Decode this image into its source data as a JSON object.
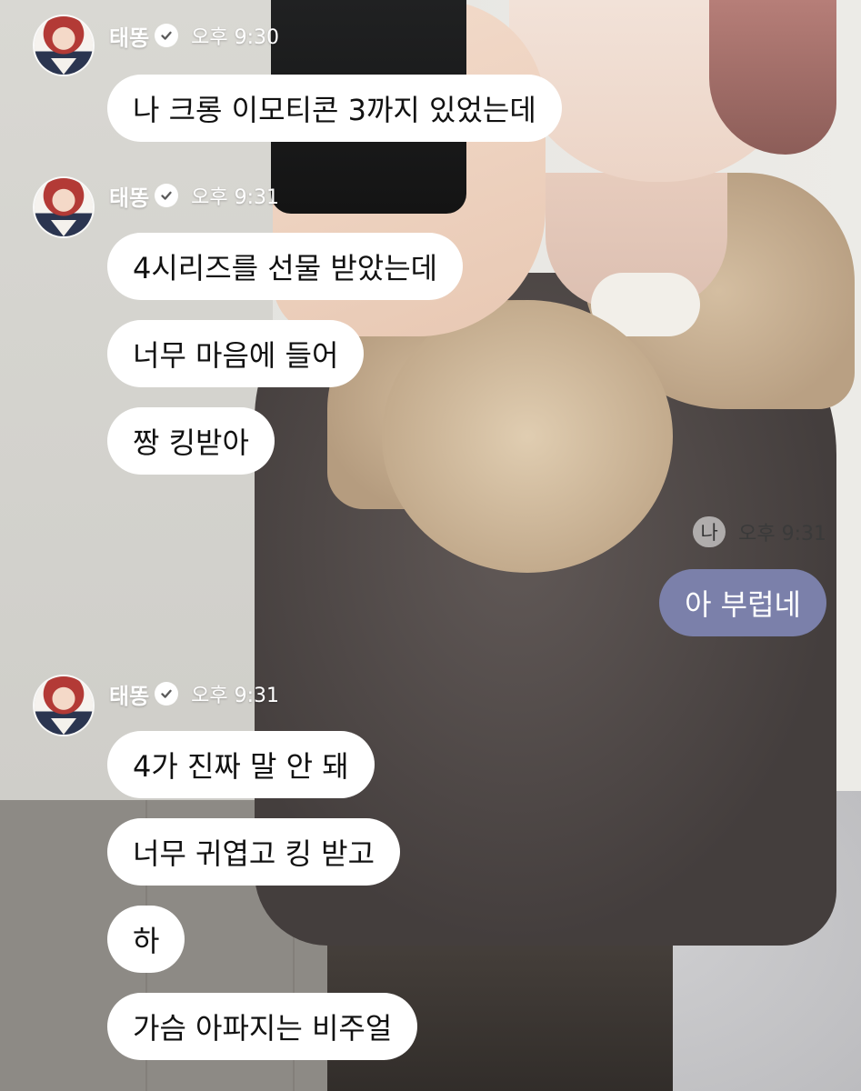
{
  "colors": {
    "incoming_bubble": "#ffffff",
    "outgoing_bubble": "#7b80aa",
    "verified_badge": "#5b5b5b"
  },
  "chat": {
    "groups": [
      {
        "sender": "태똥",
        "time": "오후 9:30",
        "messages": [
          "나 크롱 이모티콘 3까지 있었는데"
        ]
      },
      {
        "sender": "태똥",
        "time": "오후 9:31",
        "messages": [
          "4시리즈를 선물 받았는데",
          "너무 마음에 들어",
          "짱 킹받아"
        ]
      },
      {
        "sender_me": "나",
        "time": "오후 9:31",
        "messages": [
          "아 부럽네"
        ]
      },
      {
        "sender": "태똥",
        "time": "오후 9:31",
        "messages": [
          "4가 진짜 말 안 돼",
          "너무 귀엽고 킹 받고",
          "하",
          "가슴 아파지는 비주얼"
        ]
      }
    ]
  }
}
